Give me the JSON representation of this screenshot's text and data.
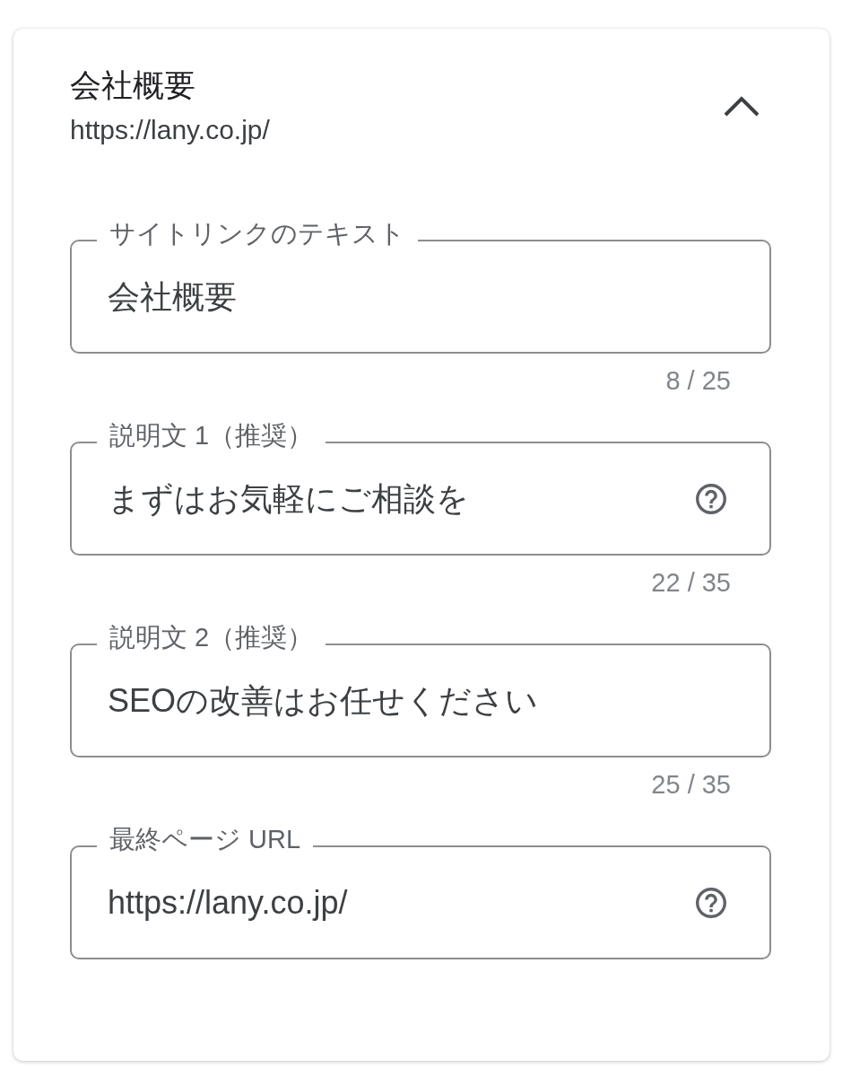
{
  "section": {
    "title": "会社概要",
    "url": "https://lany.co.jp/",
    "expanded": true
  },
  "fields": [
    {
      "label": "サイトリンクのテキスト",
      "value": "会社概要",
      "counter": "8 / 25",
      "help": false
    },
    {
      "label": "説明文 1（推奨）",
      "value": "まずはお気軽にご相談を",
      "counter": "22 / 35",
      "help": true
    },
    {
      "label": "説明文 2（推奨）",
      "value": "SEOの改善はお任せください",
      "counter": "25 / 35",
      "help": false
    },
    {
      "label": "最終ページ URL",
      "value": "https://lany.co.jp/",
      "help": true
    }
  ]
}
